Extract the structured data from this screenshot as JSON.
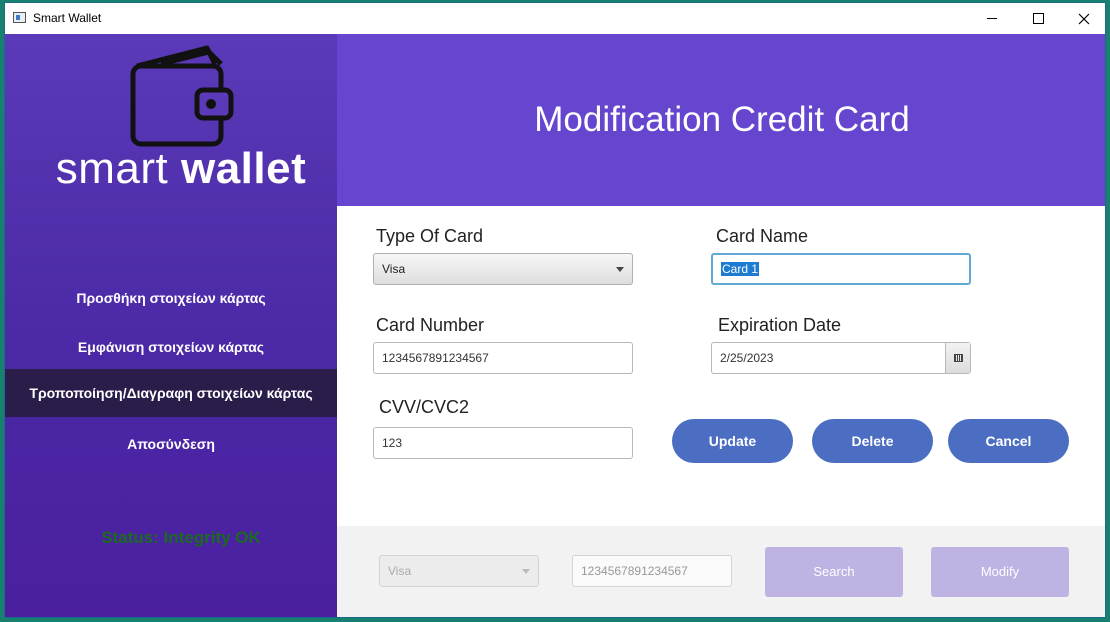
{
  "window": {
    "title": "Smart Wallet"
  },
  "sidebar": {
    "brand_light": "smart",
    "brand_bold": "wallet",
    "items": [
      {
        "label": "Προσθήκη στοιχείων κάρτας"
      },
      {
        "label": "Εμφάνιση στοιχείων κάρτας"
      },
      {
        "label": "Τροποποίηση/Διαγραφη στοιχείων κάρτας"
      },
      {
        "label": "Αποσύνδεση"
      }
    ],
    "status": "Status: Integrity OK"
  },
  "header": {
    "title": "Modification Credit Card"
  },
  "form": {
    "type_label": "Type Of Card",
    "type_value": "Visa",
    "name_label": "Card Name",
    "name_value": "Card 1",
    "number_label": "Card Number",
    "number_value": "1234567891234567",
    "exp_label": "Expiration Date",
    "exp_value": "2/25/2023",
    "cvv_label": "CVV/CVC2",
    "cvv_value": "123",
    "update_label": "Update",
    "delete_label": "Delete",
    "cancel_label": "Cancel"
  },
  "bottom": {
    "type_value": "Visa",
    "number_value": "1234567891234567",
    "search_label": "Search",
    "modify_label": "Modify"
  },
  "colors": {
    "header": "#6646cf",
    "sidebar": "#4a28a6",
    "active_nav": "#2a1d4a",
    "button": "#4b6dc2",
    "disabled_button": "#bfb3e4",
    "status": "#1b6b1f"
  },
  "icons": {
    "app": "window-icon",
    "logo": "wallet-icon",
    "calendar": "calendar-icon"
  }
}
